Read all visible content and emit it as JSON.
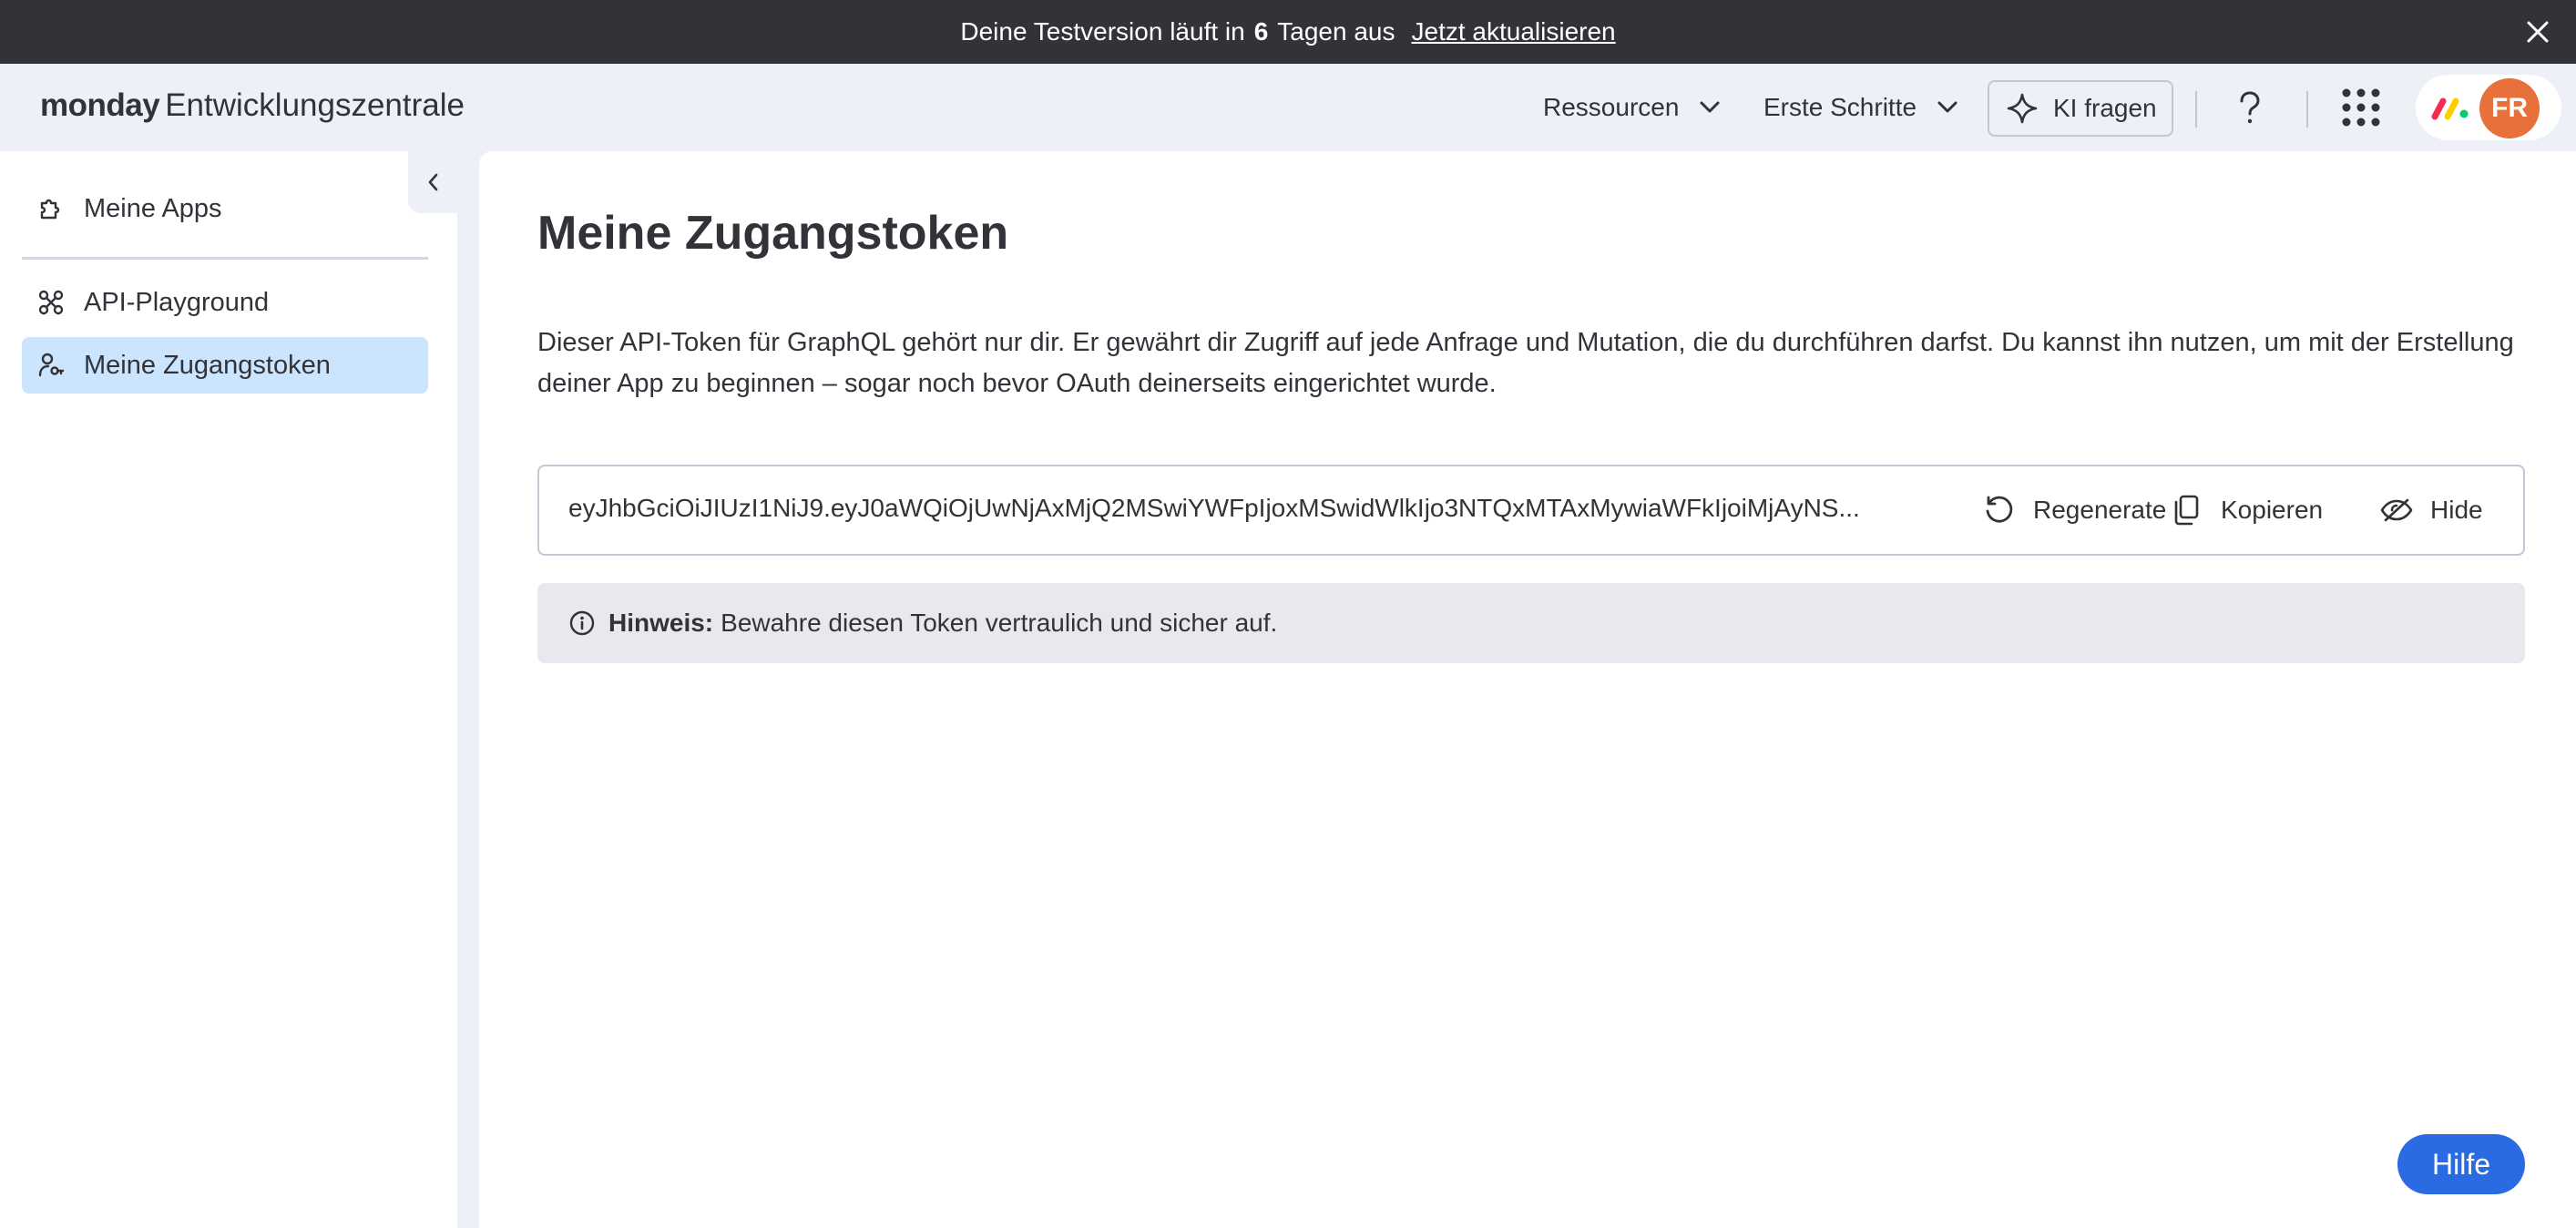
{
  "banner": {
    "text_before": "Deine Testversion läuft in",
    "days": "6",
    "text_after": "Tagen aus",
    "upgrade_link": "Jetzt aktualisieren"
  },
  "header": {
    "brand_bold": "monday",
    "brand_title": "Entwicklungszentrale",
    "nav_resources": "Ressourcen",
    "nav_first_steps": "Erste Schritte",
    "ask_ai": "KI fragen",
    "avatar_initials": "FR"
  },
  "sidebar": {
    "items": [
      {
        "label": "Meine Apps"
      },
      {
        "label": "API-Playground"
      },
      {
        "label": "Meine Zugangstoken"
      }
    ]
  },
  "main": {
    "title": "Meine Zugangstoken",
    "description": "Dieser API-Token für GraphQL gehört nur dir. Er gewährt dir Zugriff auf jede Anfrage und Mutation, die du durchführen darfst. Du kannst ihn nutzen, um mit der Erstellung deiner App zu beginnen – sogar noch bevor OAuth deinerseits eingerichtet wurde.",
    "token": "eyJhbGciOiJIUzI1NiJ9.eyJ0aWQiOjUwNjAxMjQ2MSwiYWFpIjoxMSwidWlkIjo3NTQxMTAxMywiaWFkIjoiMjAyNS...",
    "actions": {
      "regenerate": "Regenerate",
      "copy": "Kopieren",
      "hide": "Hide"
    },
    "note_label": "Hinweis:",
    "note_text": "Bewahre diesen Token vertraulich und sicher auf."
  },
  "help_button": "Hilfe",
  "colors": {
    "banner_bg": "#323338",
    "app_bg": "#eef0f8",
    "active_item": "#cce5ff",
    "primary": "#2a6be3",
    "avatar": "#e8703a"
  }
}
